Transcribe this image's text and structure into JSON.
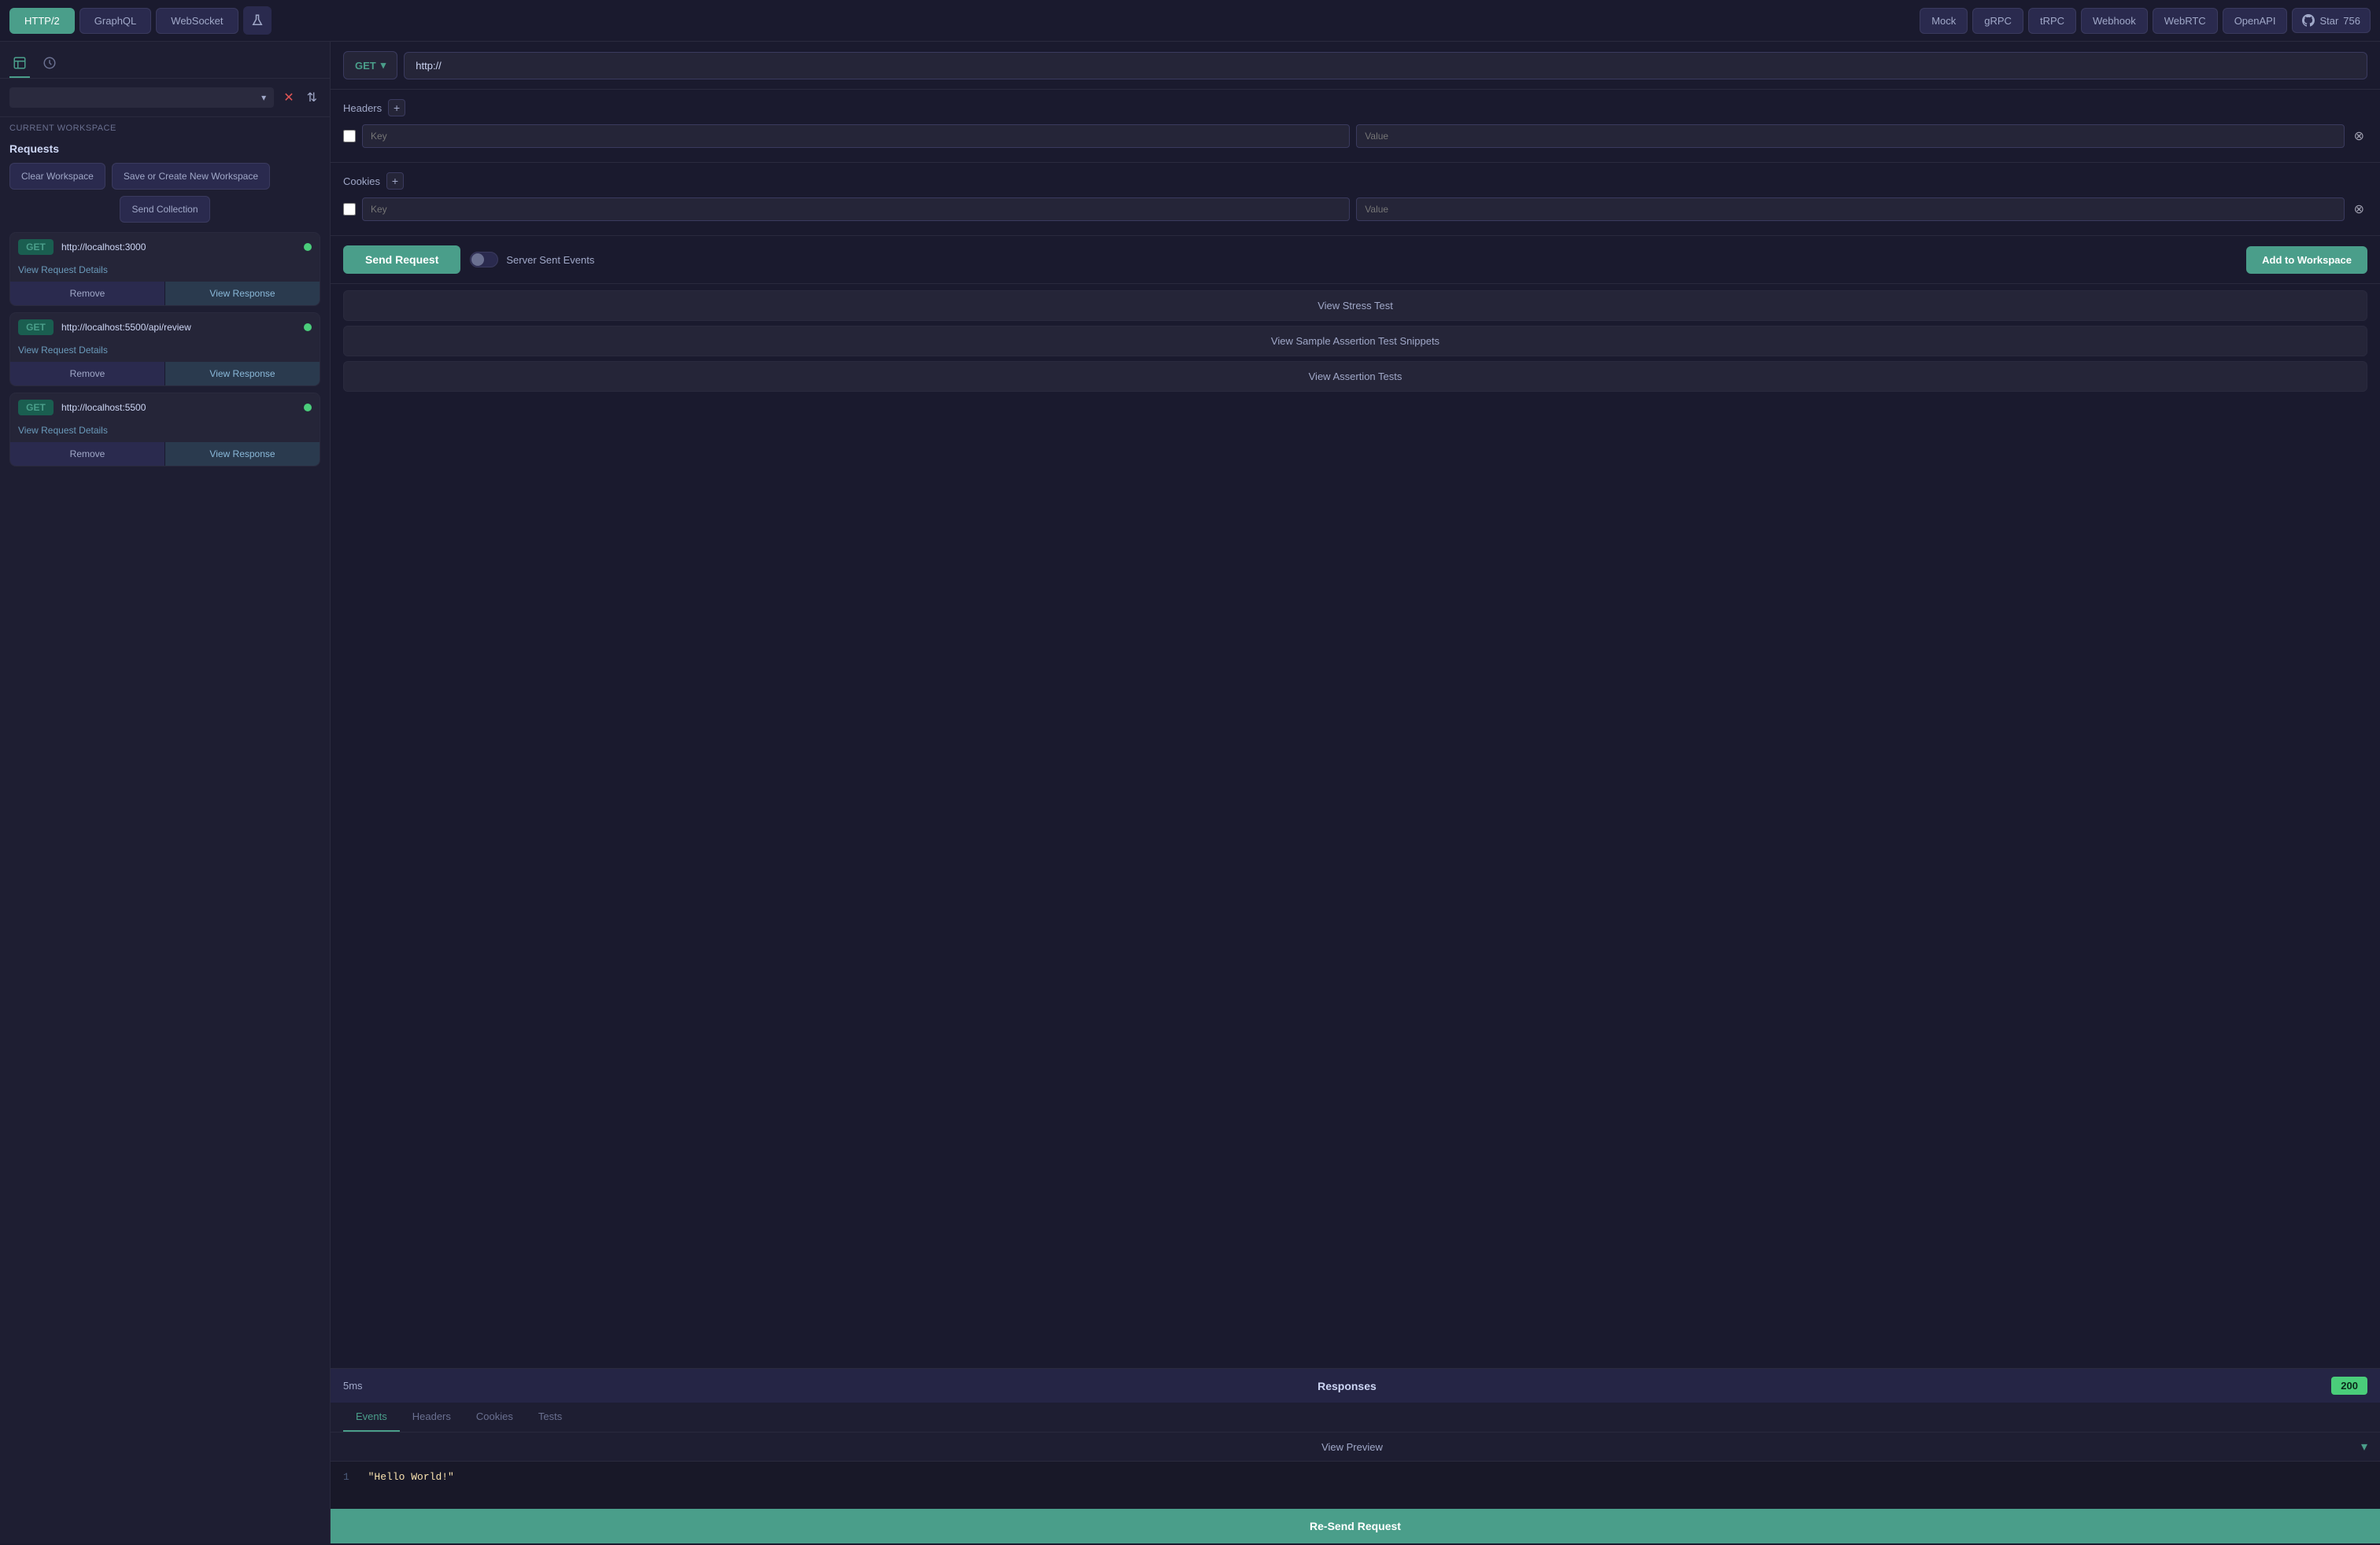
{
  "topbar": {
    "protocols": [
      {
        "label": "HTTP/2",
        "active": true
      },
      {
        "label": "GraphQL",
        "active": false
      },
      {
        "label": "WebSocket",
        "active": false
      }
    ],
    "tools": [
      {
        "label": "Mock"
      },
      {
        "label": "gRPC"
      },
      {
        "label": "tRPC"
      },
      {
        "label": "Webhook"
      },
      {
        "label": "WebRTC"
      },
      {
        "label": "OpenAPI"
      }
    ],
    "github": {
      "label": "Star",
      "count": "756"
    }
  },
  "sidebar": {
    "tabs": [
      {
        "label": "collection",
        "active": true,
        "icon": "📁"
      },
      {
        "label": "history",
        "active": false,
        "icon": "🕐"
      }
    ],
    "workspace_label": "Current Workspace",
    "requests_title": "Requests",
    "actions": {
      "clear_workspace": "Clear Workspace",
      "save_or_create": "Save or Create New Workspace",
      "send_collection": "Send Collection"
    },
    "requests": [
      {
        "method": "GET",
        "url": "http://localhost:3000",
        "status": "green",
        "details_label": "View Request Details",
        "remove_label": "Remove",
        "view_response_label": "View Response"
      },
      {
        "method": "GET",
        "url": "http://localhost:5500/api/review",
        "status": "green",
        "details_label": "View Request Details",
        "remove_label": "Remove",
        "view_response_label": "View Response"
      },
      {
        "method": "GET",
        "url": "http://localhost:5500",
        "status": "green",
        "details_label": "View Request Details",
        "remove_label": "Remove",
        "view_response_label": "View Response"
      }
    ]
  },
  "request": {
    "method": "GET",
    "url": "http://",
    "url_placeholder": "http://",
    "headers_title": "Headers",
    "cookies_title": "Cookies",
    "key_placeholder": "Key",
    "value_placeholder": "Value",
    "send_button": "Send Request",
    "sse_label": "Server Sent Events",
    "add_workspace_button": "Add to Workspace"
  },
  "view_buttons": {
    "stress_test": "View Stress Test",
    "sample_assertion": "View Sample Assertion Test Snippets",
    "assertion_tests": "View Assertion Tests"
  },
  "response": {
    "time": "5ms",
    "title": "Responses",
    "status_code": "200",
    "tabs": [
      {
        "label": "Events",
        "active": true
      },
      {
        "label": "Headers",
        "active": false
      },
      {
        "label": "Cookies",
        "active": false
      },
      {
        "label": "Tests",
        "active": false
      }
    ],
    "preview_label": "View Preview",
    "body_line": "1",
    "body_content": "\"Hello World!\"",
    "resend_button": "Re-Send Request"
  }
}
